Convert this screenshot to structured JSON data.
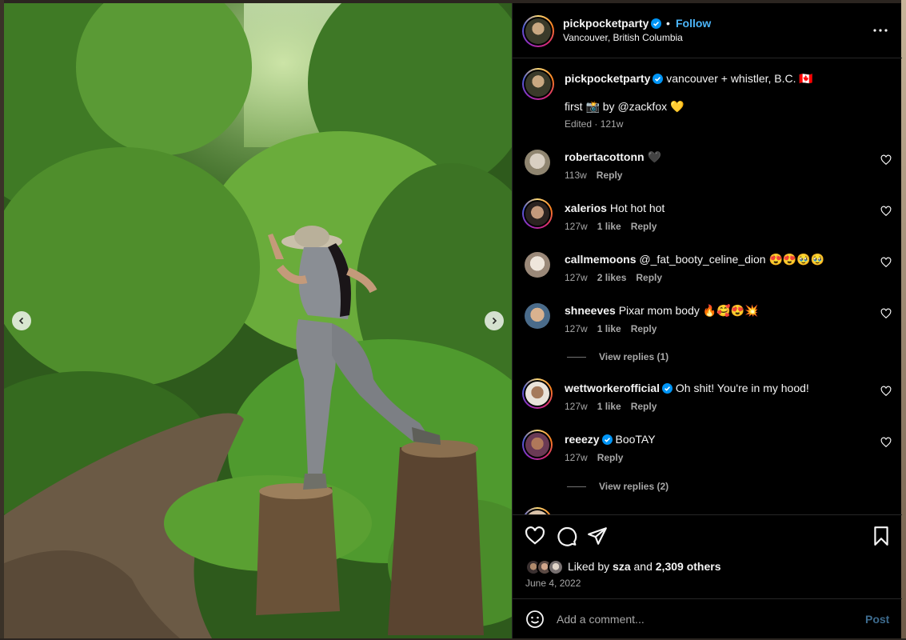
{
  "post": {
    "username": "pickpocketparty",
    "follow_label": "Follow",
    "location": "Vancouver, British Columbia",
    "caption_text": "vancouver + whistler, B.C. 🇨🇦",
    "caption_line2": "first 📸 by @zackfox 💛",
    "caption_meta": "Edited · 121w"
  },
  "comments": [
    {
      "user": "robertacottonn",
      "text": "🖤",
      "time": "113w",
      "likes": "",
      "reply": "Reply",
      "verified": false
    },
    {
      "user": "xalerios",
      "text": "Hot hot hot",
      "time": "127w",
      "likes": "1 like",
      "reply": "Reply",
      "verified": false
    },
    {
      "user": "callmemoons",
      "text": "@_fat_booty_celine_dion 😍😍🥹🥹",
      "time": "127w",
      "likes": "2 likes",
      "reply": "Reply",
      "verified": false
    },
    {
      "user": "shneeves",
      "text": "Pixar mom body 🔥🥰😍💥",
      "time": "127w",
      "likes": "1 like",
      "reply": "Reply",
      "verified": false
    },
    {
      "user": "wettworkerofficial",
      "text": "Oh shit! You're in my hood!",
      "time": "127w",
      "likes": "1 like",
      "reply": "Reply",
      "verified": true
    },
    {
      "user": "reeezy",
      "text": "BooTAY",
      "time": "127w",
      "likes": "",
      "reply": "Reply",
      "verified": true
    }
  ],
  "view_replies": [
    "View replies (1)",
    "View replies (2)"
  ],
  "likes": {
    "prefix": "Liked by",
    "user": "sza",
    "middle": "and",
    "others": "2,309 others"
  },
  "date": "June 4, 2022",
  "composer": {
    "placeholder": "Add a comment...",
    "post_label": "Post"
  },
  "colors": {
    "accent": "#4cb5f9",
    "verified": "#0095f6",
    "background": "#000000",
    "muted": "#a8a8a8"
  },
  "icons": [
    "verified-badge-icon",
    "more-options-icon",
    "heart-icon",
    "comment-icon",
    "share-icon",
    "bookmark-icon",
    "emoji-icon",
    "chevron-left-icon",
    "chevron-right-icon"
  ]
}
